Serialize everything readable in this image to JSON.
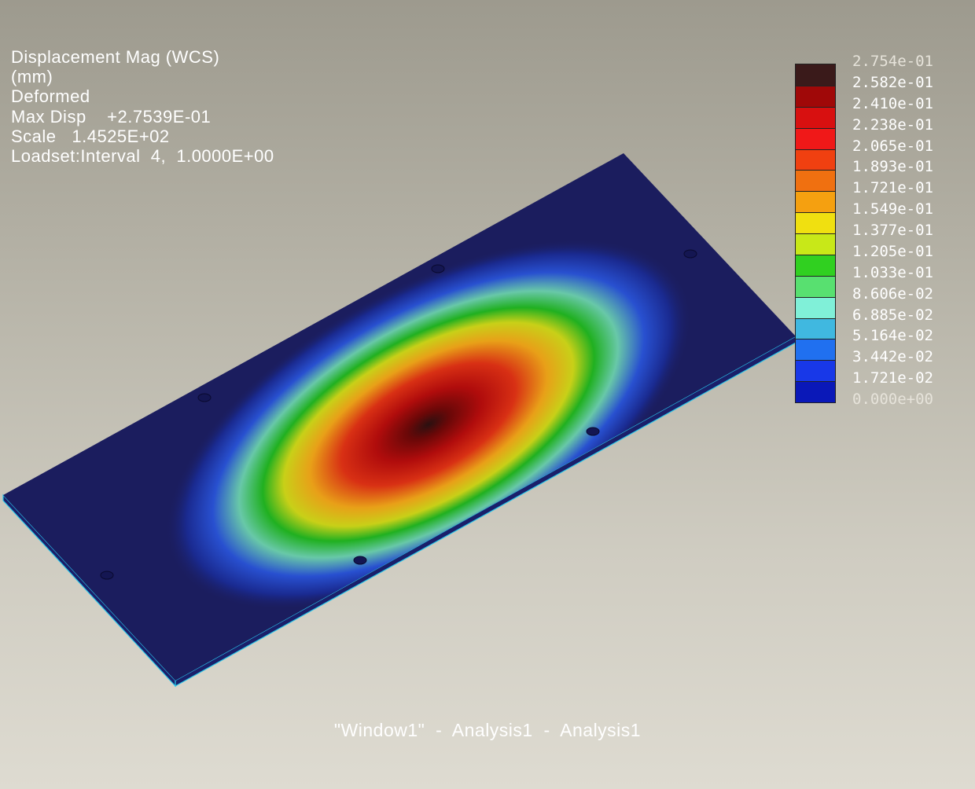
{
  "info": {
    "line1": "Displacement Mag (WCS)",
    "line2": "(mm)",
    "line3": "Deformed",
    "line4": "Max Disp    +2.7539E-01",
    "line5": "Scale   1.4525E+02",
    "line6": "Loadset:Interval  4,  1.0000E+00"
  },
  "legend": {
    "labels": [
      "2.754e-01",
      "2.582e-01",
      "2.410e-01",
      "2.238e-01",
      "2.065e-01",
      "1.893e-01",
      "1.721e-01",
      "1.549e-01",
      "1.377e-01",
      "1.205e-01",
      "1.033e-01",
      "8.606e-02",
      "6.885e-02",
      "5.164e-02",
      "3.442e-02",
      "1.721e-02",
      "0.000e+00"
    ],
    "colors": [
      "#3a1a1a",
      "#a00808",
      "#d81010",
      "#f01818",
      "#f04010",
      "#f07010",
      "#f5a010",
      "#f0e010",
      "#c8e818",
      "#30d020",
      "#58e070",
      "#80f0d8",
      "#40b8e0",
      "#2070f0",
      "#1838e8",
      "#0a18b8"
    ]
  },
  "caption": "\"Window1\"  -  Analysis1  -  Analysis1",
  "colors": {
    "plate": "#1b1d5e",
    "edge": "#29c6e8"
  }
}
